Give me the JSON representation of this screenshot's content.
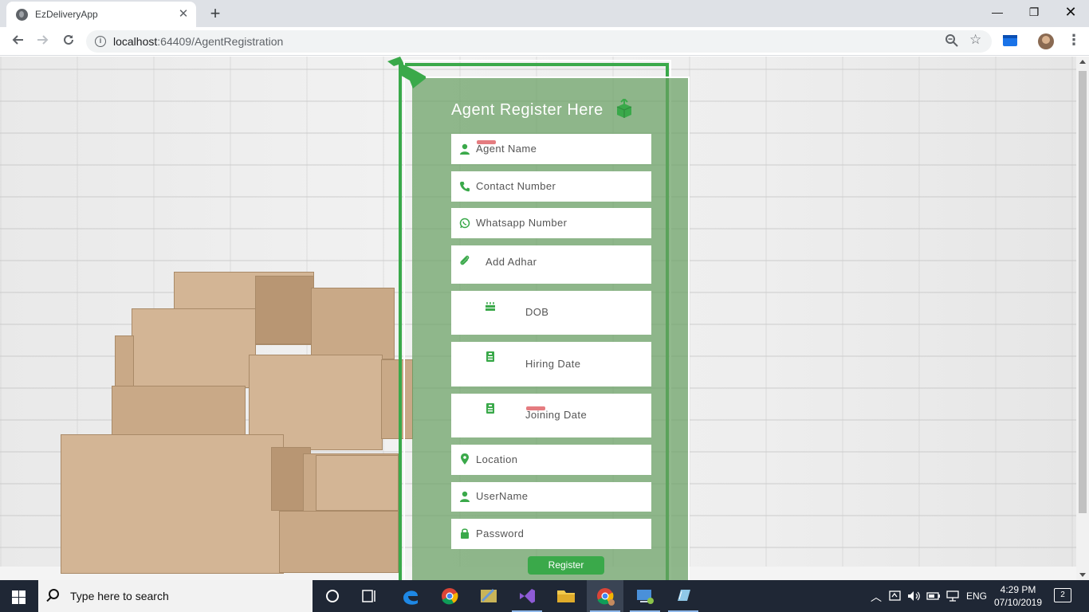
{
  "browser": {
    "tab_title": "EzDeliveryApp",
    "tab_close": "✕",
    "new_tab": "+",
    "url_host": "localhost",
    "url_rest": ":64409/AgentRegistration",
    "window_minimize": "—",
    "window_maximize": "❐",
    "window_close": "✕"
  },
  "form": {
    "title": "Agent Register Here",
    "fields": [
      {
        "placeholder": "Agent Name",
        "icon": "user-icon"
      },
      {
        "placeholder": "Contact Number",
        "icon": "phone-icon"
      },
      {
        "placeholder": "Whatsapp Number",
        "icon": "whatsapp-icon"
      },
      {
        "placeholder": "Add Adhar",
        "icon": "paperclip-icon"
      },
      {
        "placeholder": "DOB",
        "icon": "cake-icon"
      },
      {
        "placeholder": "Hiring Date",
        "icon": "id-badge-icon"
      },
      {
        "placeholder": "Joining Date",
        "icon": "id-badge-icon"
      },
      {
        "placeholder": "Location",
        "icon": "map-marker-icon"
      },
      {
        "placeholder": "UserName",
        "icon": "user-icon"
      },
      {
        "placeholder": "Password",
        "icon": "lock-icon"
      }
    ],
    "register_label": "Register"
  },
  "taskbar": {
    "search_placeholder": "Type here to search",
    "language": "ENG",
    "time": "4:29 PM",
    "date": "07/10/2019",
    "notification_count": "2"
  },
  "colors": {
    "accent_green": "#3aa94a",
    "panel_green": "#68a062"
  }
}
